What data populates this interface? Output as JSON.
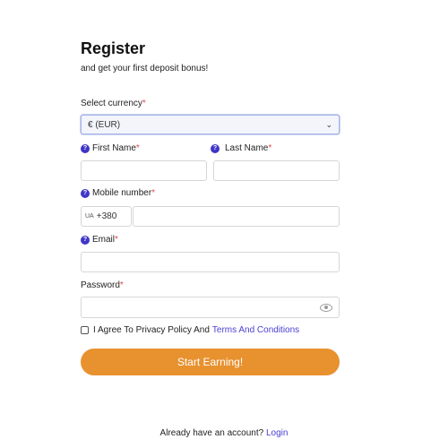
{
  "header": {
    "title": "Register",
    "subtitle": "and get your first deposit bonus!"
  },
  "form": {
    "currency": {
      "label": "Select currency",
      "required_mark": "*",
      "value": "€ (EUR)"
    },
    "first_name": {
      "label": "First Name",
      "required_mark": "*",
      "value": ""
    },
    "last_name": {
      "label": "Last Name",
      "required_mark": "*",
      "value": ""
    },
    "mobile": {
      "label": "Mobile number",
      "required_mark": "*",
      "country_code": "UA",
      "dial_code": "+380",
      "value": ""
    },
    "email": {
      "label": "Email",
      "required_mark": "*",
      "value": ""
    },
    "password": {
      "label": "Password",
      "required_mark": "*",
      "value": ""
    },
    "terms": {
      "text": "I Agree To Privacy Policy And",
      "link": "Terms And Conditions",
      "checked": false
    },
    "submit_label": "Start Earning!"
  },
  "footer": {
    "text": "Already have an account?",
    "link": "Login"
  },
  "colors": {
    "accent": "#e8912f",
    "link": "#4a3fd1",
    "help_icon": "#3f35c7",
    "required": "#e5484d"
  },
  "icons": {
    "help": "question-icon",
    "show_password": "eye-icon",
    "select_arrow": "chevron-down-icon"
  }
}
